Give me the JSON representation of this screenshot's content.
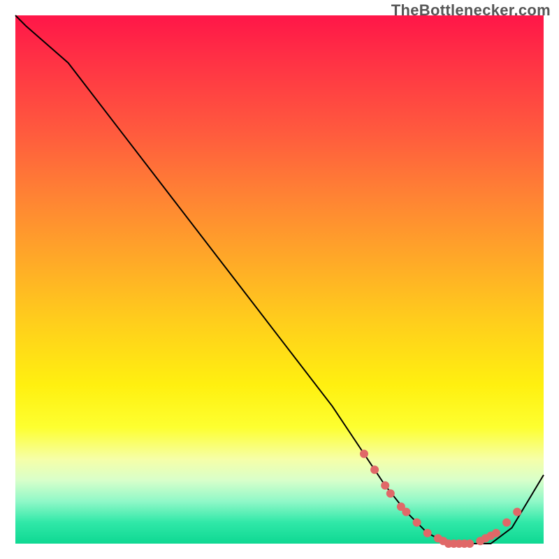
{
  "watermark": "TheBottlenecker.com",
  "chart_data": {
    "type": "line",
    "title": "",
    "xlabel": "",
    "ylabel": "",
    "xlim": [
      0,
      100
    ],
    "ylim": [
      0,
      100
    ],
    "x": [
      0,
      2,
      10,
      20,
      30,
      40,
      50,
      60,
      66,
      70,
      74,
      78,
      82,
      86,
      90,
      94,
      100
    ],
    "values": [
      100,
      98,
      91,
      78,
      65,
      52,
      39,
      26,
      17,
      11,
      6,
      2,
      0,
      0,
      0,
      3,
      13
    ],
    "marker_x": [
      66,
      68,
      70,
      71,
      73,
      74,
      76,
      78,
      80,
      81,
      82,
      83,
      84,
      85,
      86,
      88,
      89,
      90,
      91,
      93,
      95
    ],
    "marker_y": [
      17,
      14,
      11,
      9.5,
      7,
      6,
      4,
      2,
      1,
      0.5,
      0,
      0,
      0,
      0,
      0,
      0.5,
      1,
      1.5,
      2,
      4,
      6
    ],
    "gradient": {
      "top_color": "#ff1648",
      "bottom_color": "#0ed892",
      "description": "vertical rainbow gradient red-to-green indicating bottleneck severity"
    }
  }
}
